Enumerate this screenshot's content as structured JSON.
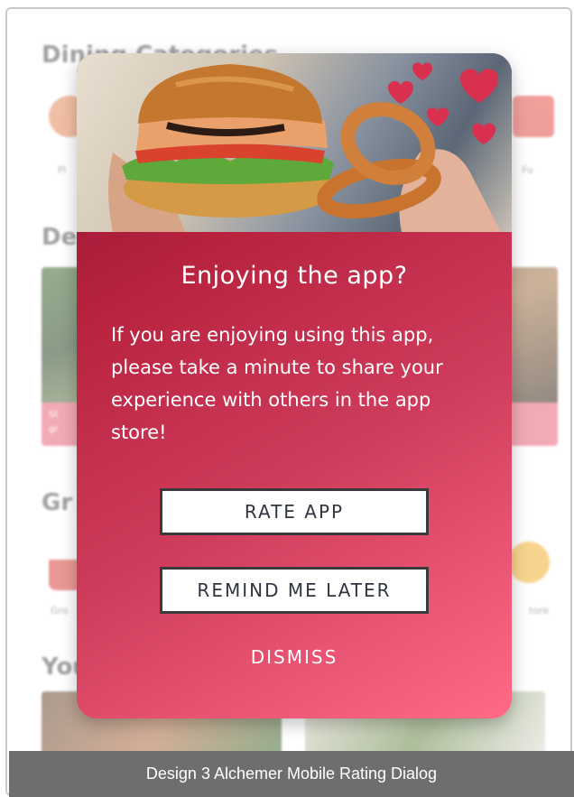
{
  "background": {
    "heading_1": "Dining Categories",
    "heading_2": "De",
    "heading_3": "Gr",
    "heading_4": "You",
    "cat_label_left": "Pi",
    "cat_label_right": "Fo",
    "grocery_label_left": "Gro",
    "grocery_label_right": "tore"
  },
  "dialog": {
    "title": "Enjoying the app?",
    "message": "If you are enjoying using this app, please take a minute to share your experience with others in the app store!",
    "rate_label": "RATE APP",
    "remind_label": "REMIND ME LATER",
    "dismiss_label": "DISMISS",
    "accent_gradient_start": "#8e1030",
    "accent_gradient_end": "#ff6a86",
    "heart_color": "#d9304f"
  },
  "caption": {
    "text": "Design 3 Alchemer Mobile Rating Dialog"
  }
}
